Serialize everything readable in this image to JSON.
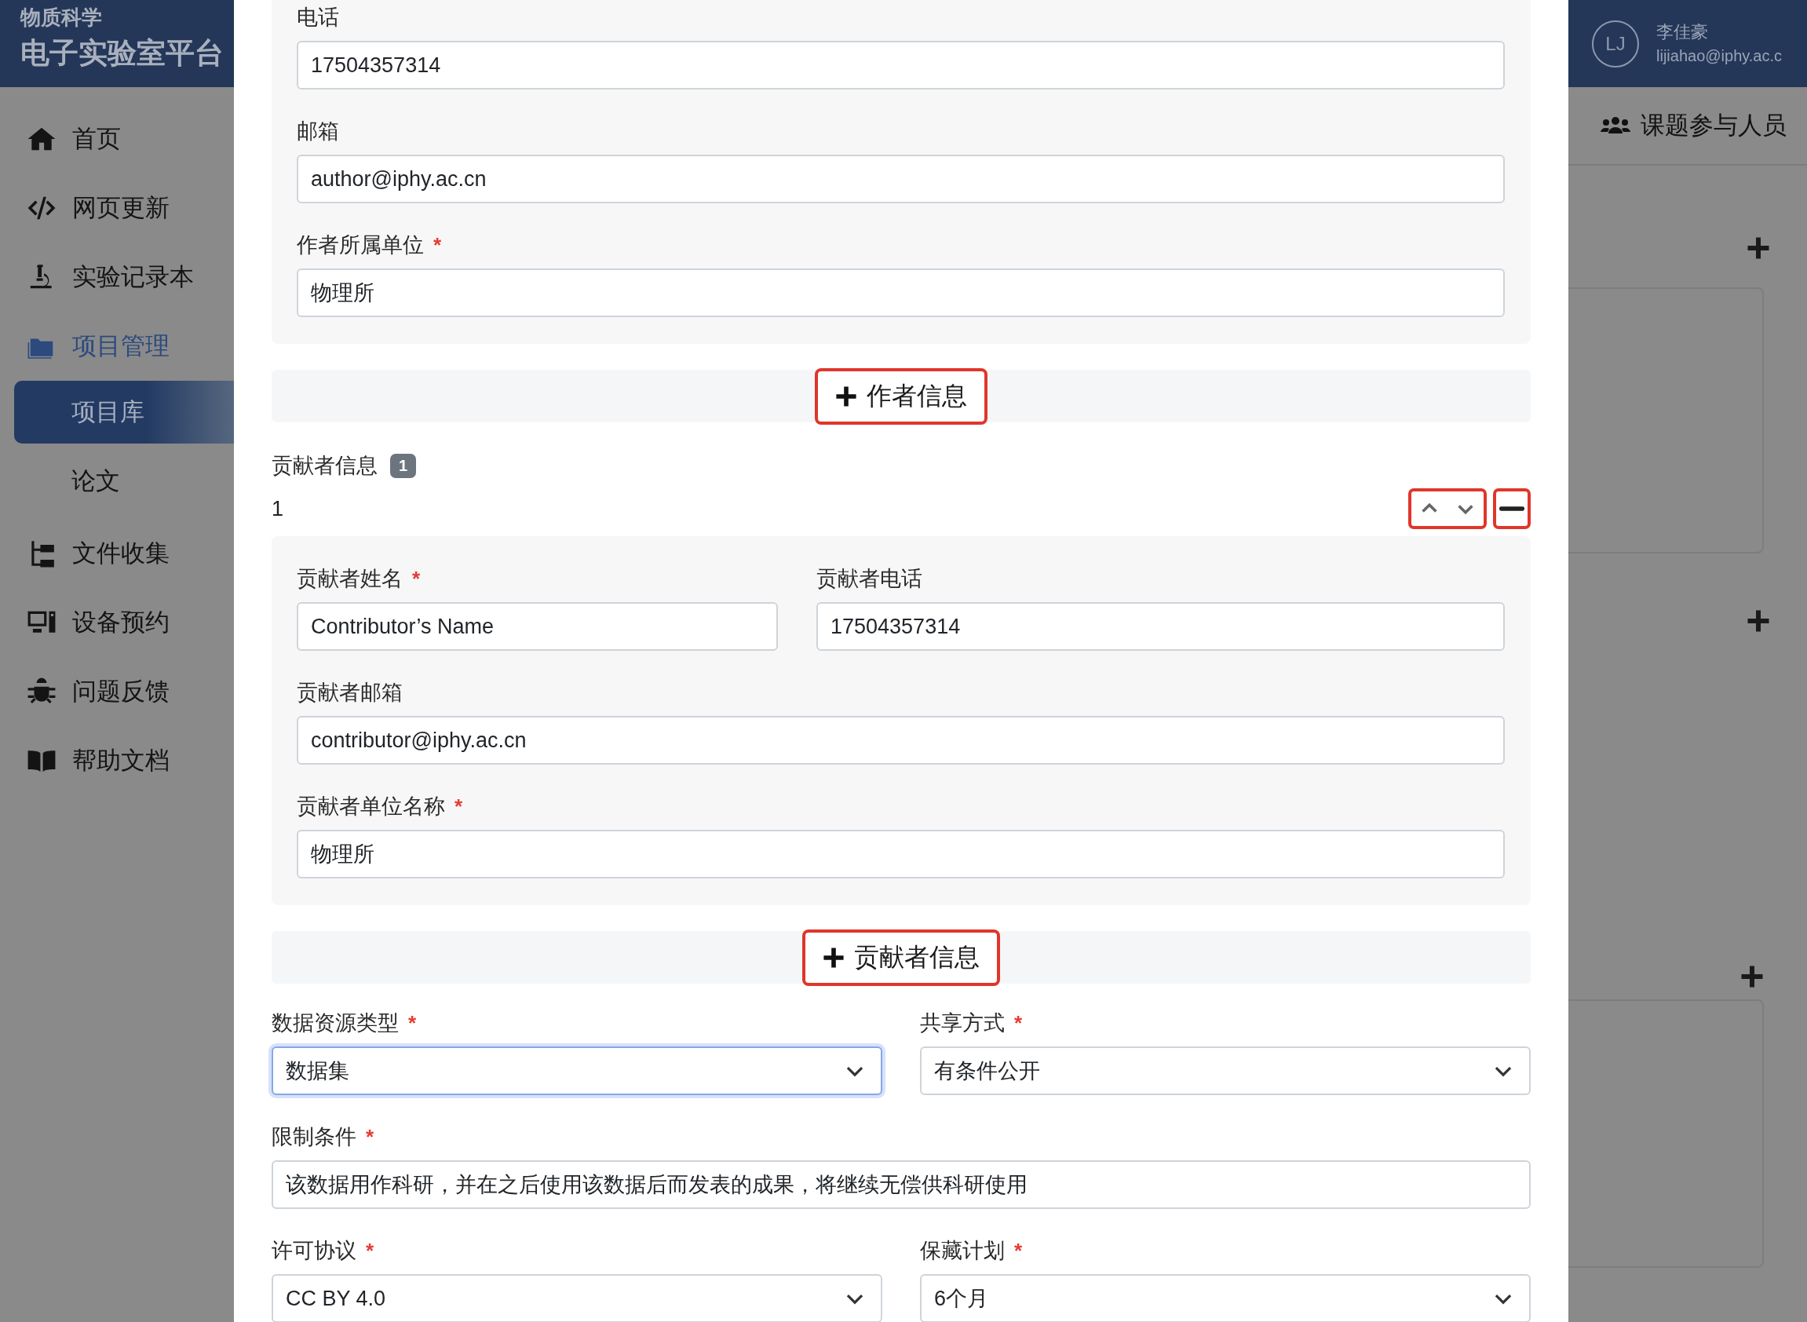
{
  "brand": {
    "subtitle": "物质科学",
    "title": "电子实验室平台"
  },
  "user": {
    "initials": "LJ",
    "name": "李佳豪",
    "email": "lijiahao@iphy.ac.c"
  },
  "sidebar": {
    "items": [
      {
        "label": "首页",
        "selected": false
      },
      {
        "label": "网页更新",
        "selected": false
      },
      {
        "label": "实验记录本",
        "selected": false
      },
      {
        "label": "项目管理",
        "selected": false,
        "children": [
          {
            "label": "项目库",
            "selected": true
          },
          {
            "label": "论文",
            "selected": false
          }
        ]
      },
      {
        "label": "文件收集",
        "selected": false
      },
      {
        "label": "设备预约",
        "selected": false
      },
      {
        "label": "问题反馈",
        "selected": false
      },
      {
        "label": "帮助文档",
        "selected": false
      }
    ]
  },
  "side_tab": {
    "label": "课题参与人员"
  },
  "author": {
    "fields": [
      {
        "label": "电话",
        "value": "17504357314"
      },
      {
        "label": "邮箱",
        "value": "author@iphy.ac.cn"
      },
      {
        "label": "作者所属单位",
        "mark": "*",
        "value": "物理所"
      }
    ],
    "add_button": {
      "label": "作者信息"
    }
  },
  "contributors": {
    "title": "贡献者信息",
    "count": "1",
    "items": [
      {
        "index": "1",
        "rows": [
          [
            {
              "label": "贡献者姓名",
              "mark": "*",
              "value": "Contributor’s Name"
            },
            {
              "label": "贡献者电话",
              "value": "17504357314"
            }
          ],
          [
            {
              "label": "贡献者邮箱",
              "value": "contributor@iphy.ac.cn"
            }
          ],
          [
            {
              "label": "贡献者单位名称",
              "mark": "*",
              "value": "物理所"
            }
          ]
        ]
      }
    ],
    "add_button": {
      "label": "贡献者信息"
    }
  },
  "settings": {
    "rows": [
      [
        {
          "label": "数据资源类型",
          "mark": "*",
          "kind": "select",
          "value": "数据集",
          "focused": true
        },
        {
          "label": "共享方式",
          "mark": "*",
          "kind": "select",
          "value": "有条件公开",
          "focused": false
        }
      ],
      [
        {
          "label": "限制条件",
          "mark": "*",
          "kind": "text",
          "value": "该数据用作科研，并在之后使用该数据后而发表的成果，将继续无偿供科研使用",
          "focused": false
        }
      ],
      [
        {
          "label": "许可协议",
          "mark": "*",
          "kind": "select",
          "value": "CC BY 4.0",
          "focused": false
        },
        {
          "label": "保藏计划",
          "mark": "*",
          "kind": "select",
          "value": "6个月",
          "focused": false
        }
      ]
    ]
  }
}
